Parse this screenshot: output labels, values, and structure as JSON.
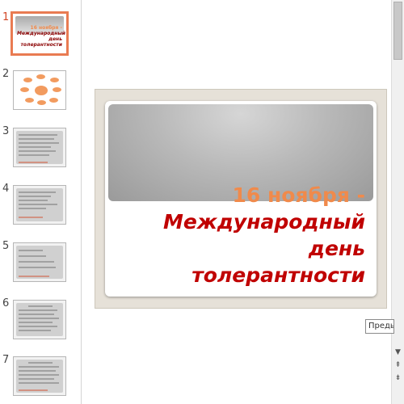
{
  "thumbnails": [
    {
      "number": "1",
      "active": true,
      "kind": "title",
      "title_line1": "16 ноября -",
      "title_line2": "Международный",
      "title_line3": "день",
      "title_line4": "толерантности"
    },
    {
      "number": "2",
      "active": false,
      "kind": "diagram"
    },
    {
      "number": "3",
      "active": false,
      "kind": "text"
    },
    {
      "number": "4",
      "active": false,
      "kind": "text"
    },
    {
      "number": "5",
      "active": false,
      "kind": "text"
    },
    {
      "number": "6",
      "active": false,
      "kind": "text"
    },
    {
      "number": "7",
      "active": false,
      "kind": "text"
    }
  ],
  "slide": {
    "title_line1": "16 ноября -",
    "title_line2": "Международный",
    "title_line3": "день",
    "title_line4": "толерантности"
  },
  "tooltip": {
    "text": "Предыд"
  },
  "scrollbar": {
    "down_icon": "▼",
    "prev_slide_icon": "⇞",
    "next_slide_icon": "⇟"
  },
  "colors": {
    "accent_orange": "#f08a4b",
    "title_red": "#c00000",
    "active_thumb_border": "#e97b52"
  }
}
